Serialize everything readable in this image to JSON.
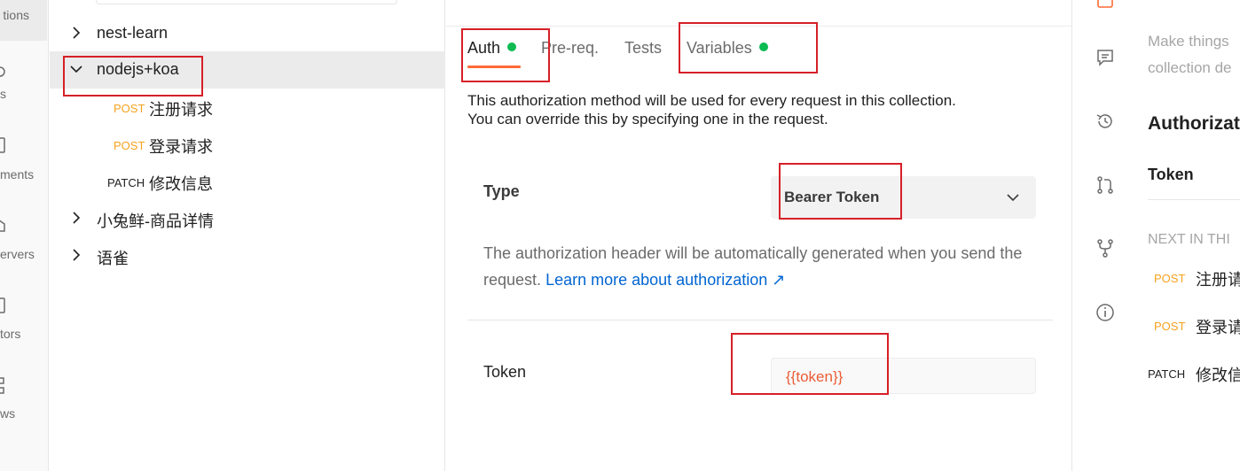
{
  "rail": {
    "labels": [
      "tions",
      "s",
      "ments",
      "ervers",
      "tors",
      "ws"
    ]
  },
  "tree": {
    "items": [
      {
        "label": "nest-learn",
        "kind": "folder",
        "expanded": false
      },
      {
        "label": "nodejs+koa",
        "kind": "folder",
        "expanded": true,
        "selected": true
      },
      {
        "method": "POST",
        "label": "注册请求",
        "kind": "request"
      },
      {
        "method": "POST",
        "label": "登录请求",
        "kind": "request"
      },
      {
        "method": "PATCH",
        "label": "修改信息",
        "kind": "request"
      },
      {
        "label": "小兔鲜-商品详情",
        "kind": "folder",
        "expanded": false
      },
      {
        "label": "语雀",
        "kind": "folder",
        "expanded": false
      }
    ]
  },
  "main": {
    "tabs": [
      {
        "label": "Auth",
        "active": true,
        "dot": true
      },
      {
        "label": "Pre-req.",
        "active": false,
        "dot": false
      },
      {
        "label": "Tests",
        "active": false,
        "dot": false
      },
      {
        "label": "Variables",
        "active": false,
        "dot": true
      }
    ],
    "description_line1": "This authorization method will be used for every request in this collection.",
    "description_line2": "You can override this by specifying one in the request.",
    "type_label": "Type",
    "type_value": "Bearer Token",
    "help_text": "The authorization header will be automatically generated when you send the request.",
    "help_link": "Learn more about authorization ↗",
    "token_label": "Token",
    "token_value": "{{token}}"
  },
  "right": {
    "muted_line1": "Make things",
    "muted_line2": "collection de",
    "auth_heading": "Authorizat",
    "auth_type": "Token",
    "next_heading": "NEXT IN THI",
    "next_items": [
      {
        "method": "POST",
        "label": "注册请"
      },
      {
        "method": "POST",
        "label": "登录请"
      },
      {
        "method": "PATCH",
        "label": "修改信"
      }
    ]
  },
  "colors": {
    "accent": "#ff6c37",
    "post": "#f6a21e",
    "dot": "#0cbb52",
    "link": "#0265d2",
    "variable": "#eb5c35",
    "annotation": "#d62027"
  }
}
